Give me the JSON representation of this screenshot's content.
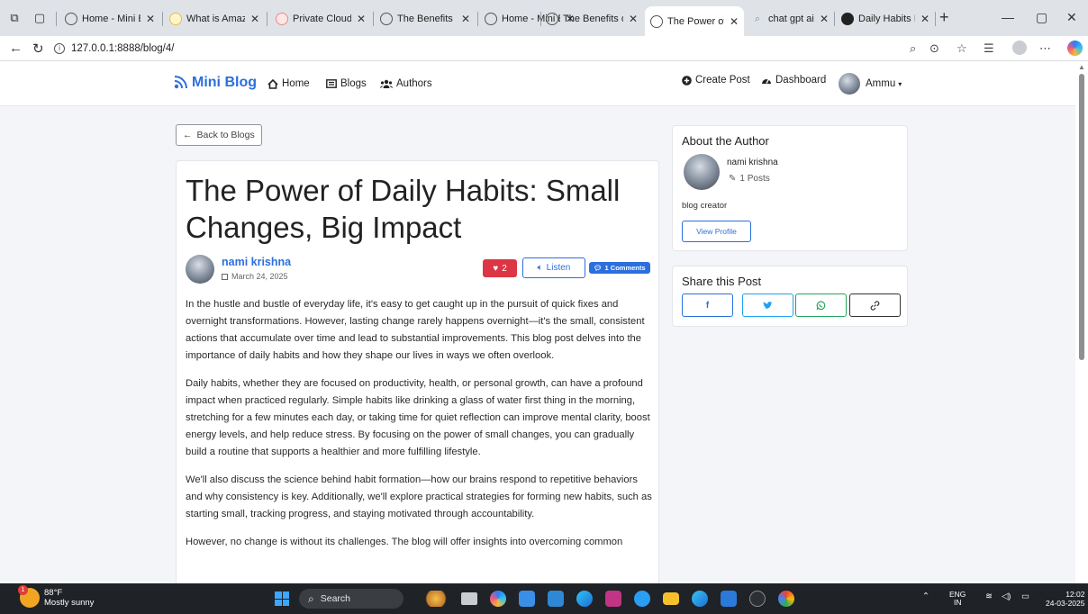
{
  "browser": {
    "tabs": [
      {
        "title": "Home - Mini B",
        "icon": "globe-icon"
      },
      {
        "title": "What is Amazo",
        "icon": "page-icon"
      },
      {
        "title": "Private Cloud",
        "icon": "page-icon"
      },
      {
        "title": "The Benefits o",
        "icon": "globe-icon"
      },
      {
        "title": "Home - Mini B",
        "icon": "globe-icon"
      },
      {
        "title": "The Benefits o",
        "icon": "globe-icon"
      },
      {
        "title": "The Power of D",
        "icon": "globe-icon",
        "active": true
      },
      {
        "title": "chat gpt ai - S",
        "icon": "search-icon"
      },
      {
        "title": "Daily Habits Ir",
        "icon": "chatgpt-icon"
      }
    ],
    "new_tab": "+",
    "url": "127.0.0.1:8888/blog/4/"
  },
  "site": {
    "brand": "Mini Blog",
    "nav": {
      "home": "Home",
      "blogs": "Blogs",
      "authors": "Authors"
    },
    "create_post": "Create Post",
    "dashboard": "Dashboard",
    "user": "Ammu"
  },
  "post": {
    "back_label": "Back to Blogs",
    "title": "The Power of Daily Habits: Small Changes, Big Impact",
    "author": "nami krishna",
    "date": "March 24, 2025",
    "likes": "2",
    "listen_label": "Listen",
    "comments_label": "1 Comments",
    "paragraphs": [
      "In the hustle and bustle of everyday life, it's easy to get caught up in the pursuit of quick fixes and overnight transformations. However, lasting change rarely happens overnight—it's the small, consistent actions that accumulate over time and lead to substantial improvements. This blog post delves into the importance of daily habits and how they shape our lives in ways we often overlook.",
      "Daily habits, whether they are focused on productivity, health, or personal growth, can have a profound impact when practiced regularly. Simple habits like drinking a glass of water first thing in the morning, stretching for a few minutes each day, or taking time for quiet reflection can improve mental clarity, boost energy levels, and help reduce stress. By focusing on the power of small changes, you can gradually build a routine that supports a healthier and more fulfilling lifestyle.",
      "We'll also discuss the science behind habit formation—how our brains respond to repetitive behaviors and why consistency is key. Additionally, we'll explore practical strategies for forming new habits, such as starting small, tracking progress, and staying motivated through accountability.",
      "However, no change is without its challenges. The blog will offer insights into overcoming common"
    ]
  },
  "sidebar": {
    "about_title": "About the Author",
    "author_name": "nami krishna",
    "author_posts": "1 Posts",
    "author_bio": "blog creator",
    "view_profile": "View Profile",
    "share_title": "Share this Post",
    "share_buttons": [
      {
        "icon": "facebook-icon",
        "glyph": "f",
        "color": "#2b6fde"
      },
      {
        "icon": "twitter-icon",
        "glyph": "❖",
        "color": "#1da1f2"
      },
      {
        "icon": "whatsapp-icon",
        "glyph": "ⓢ",
        "color": "#25a35a"
      },
      {
        "icon": "link-icon",
        "glyph": "↗",
        "color": "#333333"
      }
    ]
  },
  "taskbar": {
    "temperature": "88°F",
    "weather": "Mostly sunny",
    "weather_badge": "1",
    "search": "Search",
    "lang_top": "ENG",
    "lang_bottom": "IN",
    "time": "12:02",
    "date": "24-03-2025"
  },
  "colors": {
    "accent": "#2b6fde",
    "danger": "#dc3545",
    "taskbar": "#1f2226"
  }
}
